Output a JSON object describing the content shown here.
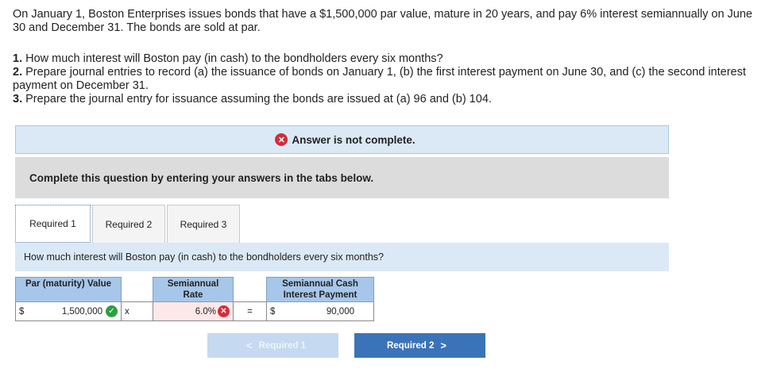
{
  "problem": {
    "intro": "On January 1, Boston Enterprises issues bonds that have a $1,500,000 par value, mature in 20 years, and pay 6% interest semiannually on June 30 and December 31. The bonds are sold at par.",
    "items": [
      {
        "num": "1.",
        "text": "How much interest will Boston pay (in cash) to the bondholders every six months?"
      },
      {
        "num": "2.",
        "text": "Prepare journal entries to record (a) the issuance of bonds on January 1, (b) the first interest payment on June 30, and (c) the second interest payment on December 31."
      },
      {
        "num": "3.",
        "text": "Prepare the journal entry for issuance assuming the bonds are issued at (a) 96 and (b) 104."
      }
    ]
  },
  "banner": {
    "text": "Answer is not complete.",
    "icon": "x-circle-icon",
    "color": "#d22c3c"
  },
  "instructions": "Complete this question by entering your answers in the tabs below.",
  "tabs": [
    {
      "label": "Required 1",
      "active": true
    },
    {
      "label": "Required 2",
      "active": false
    },
    {
      "label": "Required 3",
      "active": false
    }
  ],
  "question": "How much interest will Boston pay (in cash) to the bondholders every six months?",
  "table": {
    "headers": {
      "par": "Par (maturity) Value",
      "rate": "Semiannual Rate",
      "interest": "Semiannual Cash Interest Payment"
    },
    "row": {
      "par_currency": "$",
      "par_value": "1,500,000",
      "times": "x",
      "rate_value": "6.0%",
      "equals": "=",
      "int_currency": "$",
      "int_value": "90,000"
    }
  },
  "nav": {
    "prev_label": "Required 1",
    "next_label": "Required 2",
    "prev_chevron": "<",
    "next_chevron": ">"
  }
}
